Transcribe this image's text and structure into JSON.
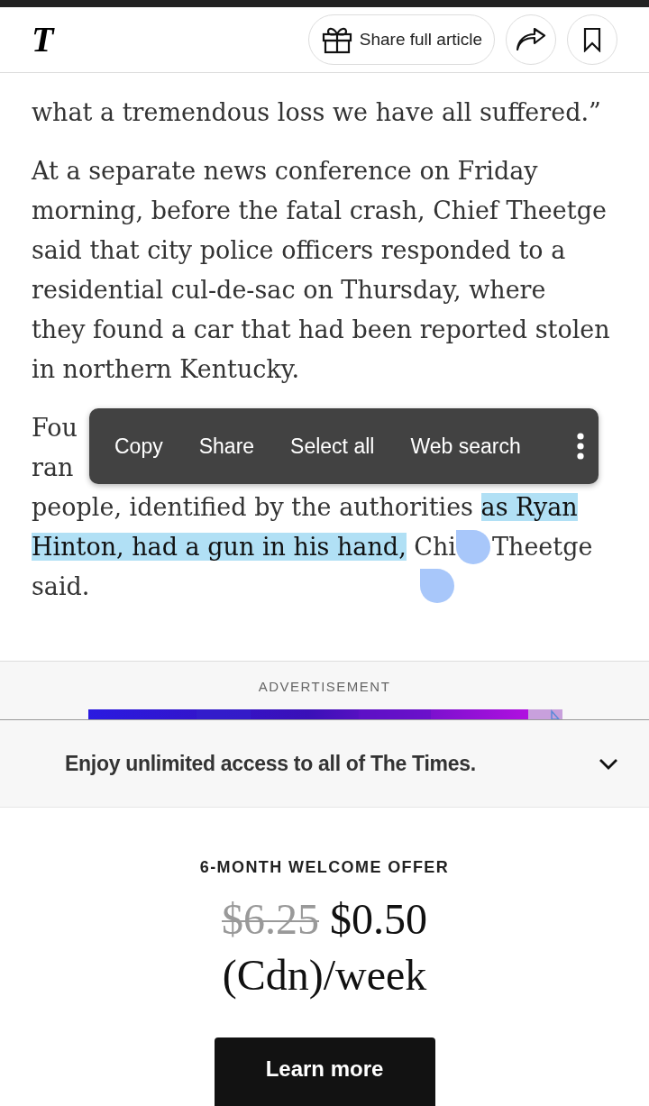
{
  "header": {
    "logo": "T",
    "share_button": "Share full article"
  },
  "article": {
    "paragraphs": [
      {
        "lines": [
          "what a tremendous loss we have all suffered.”"
        ]
      },
      {
        "lines": [
          "At a separate news conference on Friday",
          "morning, before the fatal crash, Chief Theetge",
          "said that city police officers responded to a",
          "residential cul-de-sac on Thursday, where",
          "they found a car that had been reported stolen",
          "in northern Kentucky."
        ]
      }
    ],
    "selected_paragraph": {
      "lines_before": [
        "Fou",
        "ran"
      ],
      "before_selection": "people, identified by the authorities ",
      "selection_lines": [
        "as Ryan",
        "Hinton, had a gun in his hand,"
      ],
      "after_selection": "Chi",
      "after_handle": "Theetge",
      "last_line": "said."
    }
  },
  "text_menu": {
    "items": [
      "Copy",
      "Share",
      "Select all",
      "Web search"
    ]
  },
  "advertisement": {
    "label": "ADVERTISEMENT"
  },
  "offer": {
    "banner": "Enjoy unlimited access to all of The Times.",
    "title": "6-MONTH WELCOME OFFER",
    "old_price": "$6.25",
    "price": "$0.50",
    "period": "(Cdn)/week",
    "button": "Learn more"
  }
}
